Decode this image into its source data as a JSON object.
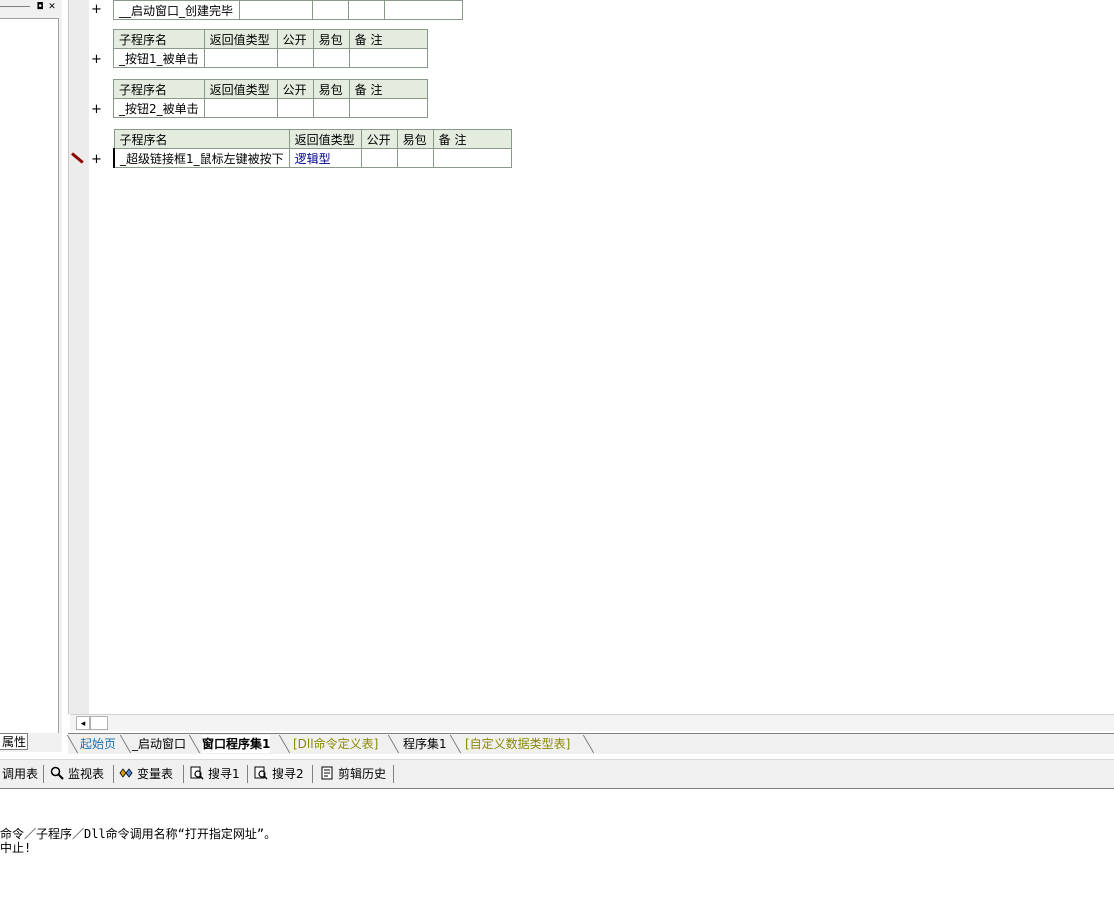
{
  "left_panel": {
    "properties_tab": "属性",
    "restore_glyph": "◘",
    "close_glyph": "✕"
  },
  "subroutine_tables": [
    {
      "name": "__启动窗口_创建完毕"
    },
    {
      "headers": [
        "子程序名",
        "返回值类型",
        "公开",
        "易包",
        "备 注"
      ],
      "row": [
        "_按钮1_被单击",
        "",
        "",
        "",
        ""
      ]
    },
    {
      "headers": [
        "子程序名",
        "返回值类型",
        "公开",
        "易包",
        "备 注"
      ],
      "row": [
        "_按钮2_被单击",
        "",
        "",
        "",
        ""
      ]
    },
    {
      "headers": [
        "子程序名",
        "返回值类型",
        "公开",
        "易包",
        "备 注"
      ],
      "row": [
        "_超级链接框1_鼠标左键被按下",
        "逻辑型",
        "",
        "",
        ""
      ]
    }
  ],
  "expand_glyph": "+",
  "scroll": {
    "left_arrow": "◂"
  },
  "tabs": [
    {
      "label": "起始页",
      "color": "#1a6fb0"
    },
    {
      "label": "_启动窗口",
      "color": "#000000"
    },
    {
      "label": "窗口程序集1",
      "color": "#000000",
      "active": true
    },
    {
      "label": "[Dll命令定义表]",
      "color": "#8a8a00"
    },
    {
      "label": "程序集1",
      "color": "#000000"
    },
    {
      "label": "[自定义数据类型表]",
      "color": "#8a8a00"
    }
  ],
  "toolbar": {
    "call_table": "调用表",
    "watch_table": "监视表",
    "variable_table": "变量表",
    "search1": "搜寻1",
    "search2": "搜寻2",
    "clip_history": "剪辑历史"
  },
  "output": {
    "line1": "命令／子程序／Dll命令调用名称“打开指定网址”。",
    "line2": "中止!"
  }
}
